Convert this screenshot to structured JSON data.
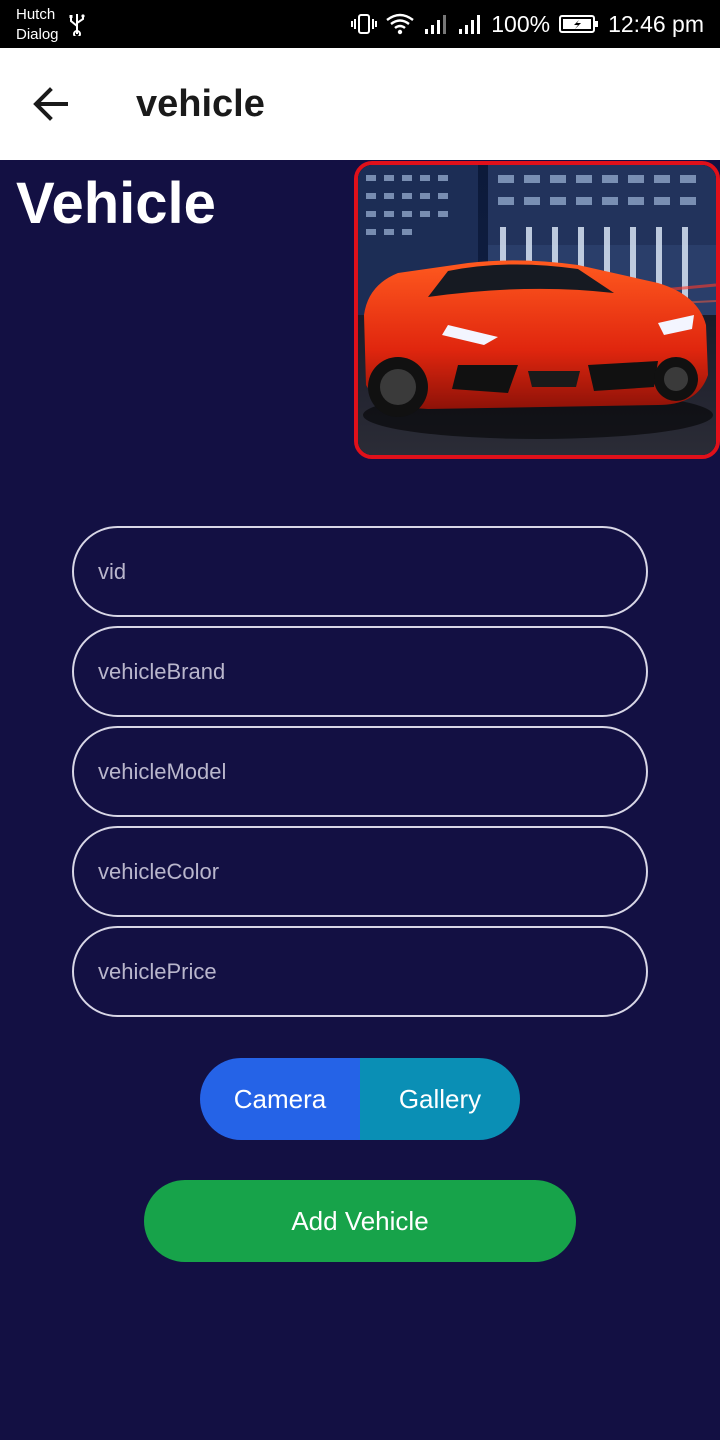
{
  "status_bar": {
    "carrier_line1": "Hutch",
    "carrier_line2": "Dialog",
    "battery_percent": "100%",
    "time": "12:46 pm",
    "icons": [
      "usb-icon",
      "vibrate-icon",
      "wifi-icon",
      "signal-icon",
      "signal-icon",
      "battery-charging-icon"
    ]
  },
  "app_bar": {
    "title": "vehicle",
    "back_icon": "arrow-left-icon"
  },
  "main": {
    "heading": "Vehicle",
    "photo": "red sports car photo",
    "fields": [
      {
        "placeholder": "vid",
        "value": ""
      },
      {
        "placeholder": "vehicleBrand",
        "value": ""
      },
      {
        "placeholder": "vehicleModel",
        "value": ""
      },
      {
        "placeholder": "vehicleColor",
        "value": ""
      },
      {
        "placeholder": "vehiclePrice",
        "value": ""
      }
    ],
    "camera_label": "Camera",
    "gallery_label": "Gallery",
    "add_label": "Add Vehicle"
  },
  "colors": {
    "background": "#131043",
    "photo_border": "#e0101a",
    "camera_button": "#2563e7",
    "gallery_button": "#0a8fb5",
    "add_button": "#17a34a"
  }
}
